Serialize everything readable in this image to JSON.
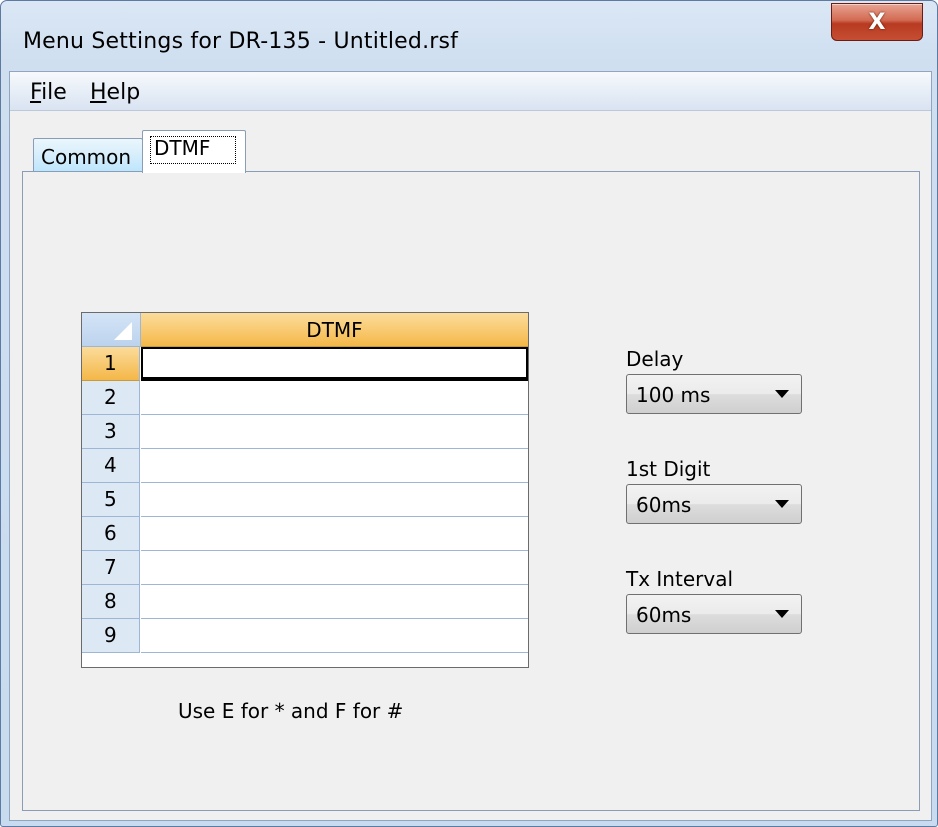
{
  "window": {
    "title": "Menu Settings for DR-135 - Untitled.rsf",
    "close_symbol": "X"
  },
  "menu": [
    {
      "mnemonic": "F",
      "rest": "ile"
    },
    {
      "mnemonic": "H",
      "rest": "elp"
    }
  ],
  "tabs": [
    {
      "label": "Common",
      "selected": false
    },
    {
      "label": "DTMF",
      "selected": true
    }
  ],
  "grid": {
    "column_header": "DTMF",
    "rows": [
      {
        "num": "1",
        "value": ""
      },
      {
        "num": "2",
        "value": ""
      },
      {
        "num": "3",
        "value": ""
      },
      {
        "num": "4",
        "value": ""
      },
      {
        "num": "5",
        "value": ""
      },
      {
        "num": "6",
        "value": ""
      },
      {
        "num": "7",
        "value": ""
      },
      {
        "num": "8",
        "value": ""
      },
      {
        "num": "9",
        "value": ""
      }
    ]
  },
  "hint": "Use E for * and F for #",
  "fields": {
    "delay": {
      "label": "Delay",
      "value": "100 ms"
    },
    "first_digit": {
      "label": "1st Digit",
      "value": "60ms"
    },
    "tx_interval": {
      "label": "Tx Interval",
      "value": "60ms"
    }
  },
  "colors": {
    "grid_header": "#f8c76a",
    "tab_active": "#bde6fd",
    "close_button": "#c64e33"
  }
}
